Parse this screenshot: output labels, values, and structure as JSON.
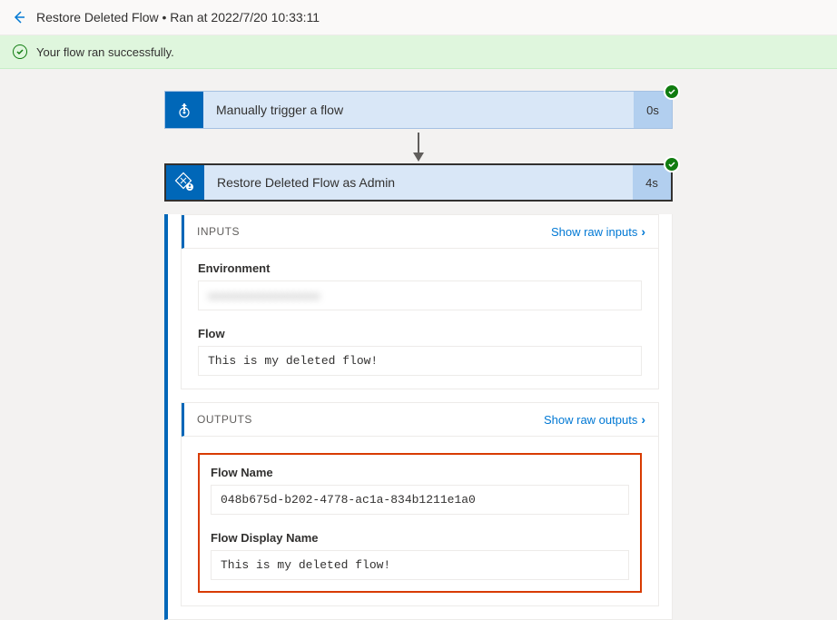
{
  "header": {
    "title": "Restore Deleted Flow  •  Ran at 2022/7/20 10:33:11"
  },
  "banner": {
    "text": "Your flow ran successfully."
  },
  "steps": {
    "trigger": {
      "title": "Manually trigger a flow",
      "duration": "0s"
    },
    "restore": {
      "title": "Restore Deleted Flow as Admin",
      "duration": "4s",
      "inputs": {
        "sectionTitle": "INPUTS",
        "showLink": "Show raw inputs",
        "environment": {
          "label": "Environment",
          "value": "xxxxxxxxxxxxxxxxxxx"
        },
        "flow": {
          "label": "Flow",
          "value": "This is my deleted flow!"
        }
      },
      "outputs": {
        "sectionTitle": "OUTPUTS",
        "showLink": "Show raw outputs",
        "flowName": {
          "label": "Flow Name",
          "value": "048b675d-b202-4778-ac1a-834b1211e1a0"
        },
        "flowDisplayName": {
          "label": "Flow Display Name",
          "value": "This is my deleted flow!"
        }
      }
    }
  }
}
